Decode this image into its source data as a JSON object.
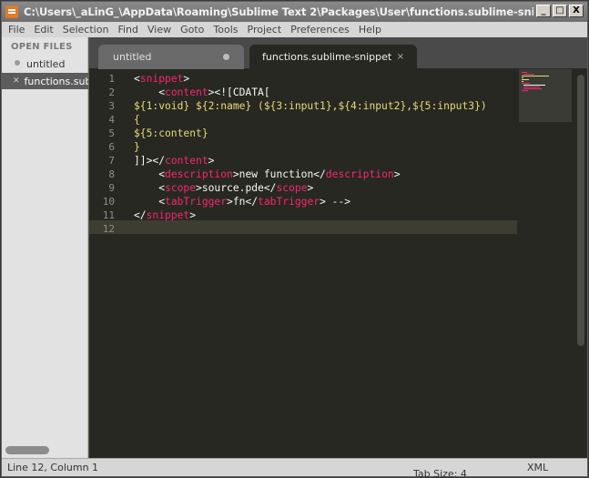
{
  "window": {
    "title": "C:\\Users\\_aLinG_\\AppData\\Roaming\\Sublime Text 2\\Packages\\User\\functions.sublime-snippet - ...",
    "controls": [
      "_",
      "□",
      "X"
    ]
  },
  "menu": [
    "File",
    "Edit",
    "Selection",
    "Find",
    "View",
    "Goto",
    "Tools",
    "Project",
    "Preferences",
    "Help"
  ],
  "sidebar": {
    "header": "OPEN FILES",
    "files": [
      {
        "name": "untitled",
        "mark": "dot"
      },
      {
        "name": "functions.sublime-snippet",
        "mark": "close"
      }
    ]
  },
  "tabs": [
    {
      "label": "untitled",
      "active": false,
      "close": "dot"
    },
    {
      "label": "functions.sublime-snippet",
      "active": true,
      "close": "×"
    }
  ],
  "editor": {
    "line_numbers": [
      "1",
      "2",
      "3",
      "4",
      "5",
      "6",
      "7",
      "8",
      "9",
      "10",
      "11",
      "12"
    ],
    "current_line": 12,
    "lines": [
      [
        {
          "t": "<",
          "c": "punc"
        },
        {
          "t": "snippet",
          "c": "tag"
        },
        {
          "t": ">",
          "c": "punc"
        }
      ],
      [
        {
          "t": "    <",
          "c": "punc"
        },
        {
          "t": "content",
          "c": "tag"
        },
        {
          "t": "><![CDATA[",
          "c": "punc"
        }
      ],
      [
        {
          "t": "${1:void} ${2:name} (${3:input1},${4:input2},${5:input3})",
          "c": "str"
        }
      ],
      [
        {
          "t": "{",
          "c": "str"
        }
      ],
      [
        {
          "t": "${5:content}",
          "c": "str"
        }
      ],
      [
        {
          "t": "}",
          "c": "str"
        }
      ],
      [
        {
          "t": "]]></",
          "c": "punc"
        },
        {
          "t": "content",
          "c": "tag"
        },
        {
          "t": ">",
          "c": "punc"
        }
      ],
      [
        {
          "t": "    <",
          "c": "punc"
        },
        {
          "t": "description",
          "c": "tag"
        },
        {
          "t": ">new function</",
          "c": "punc"
        },
        {
          "t": "description",
          "c": "tag"
        },
        {
          "t": ">",
          "c": "punc"
        }
      ],
      [
        {
          "t": "    <",
          "c": "punc"
        },
        {
          "t": "scope",
          "c": "tag"
        },
        {
          "t": ">source.pde</",
          "c": "punc"
        },
        {
          "t": "scope",
          "c": "tag"
        },
        {
          "t": ">",
          "c": "punc"
        }
      ],
      [
        {
          "t": "    <",
          "c": "punc"
        },
        {
          "t": "tabTrigger",
          "c": "tag"
        },
        {
          "t": ">fn</",
          "c": "punc"
        },
        {
          "t": "tabTrigger",
          "c": "tag"
        },
        {
          "t": "> -->",
          "c": "punc"
        }
      ],
      [
        {
          "t": "</",
          "c": "punc"
        },
        {
          "t": "snippet",
          "c": "tag"
        },
        {
          "t": ">",
          "c": "punc"
        }
      ],
      []
    ]
  },
  "status": {
    "position": "Line 12, Column 1",
    "tab_size": "Tab Size: 4",
    "syntax": "XML"
  },
  "colors": {
    "editor_bg": "#272822",
    "tag": "#f92672",
    "string": "#e6db74",
    "text": "#f8f8f2",
    "line_number": "#8f908a"
  }
}
